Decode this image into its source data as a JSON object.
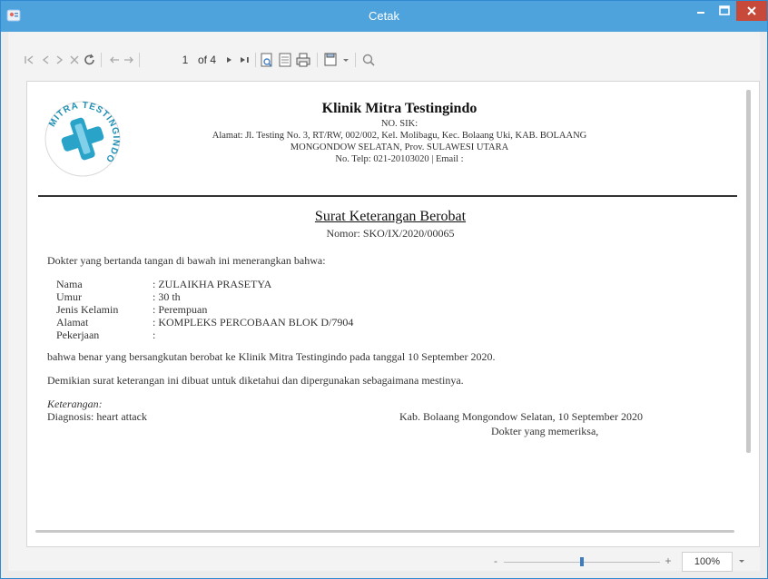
{
  "window": {
    "title": "Cetak",
    "colors": {
      "titlebar": "#4ea3dc",
      "close": "#c7493a",
      "accent": "#2f8ad1"
    }
  },
  "toolbar": {
    "page_current": "1",
    "page_total": "of 4",
    "icons": [
      "first-page-icon",
      "prev-icon",
      "next-icon",
      "stop-icon",
      "refresh-icon",
      "back-icon",
      "forward-icon",
      "first-icon",
      "prev-page-icon",
      "next-page-icon",
      "last-page-icon",
      "page-setup-icon",
      "layout-icon",
      "print-icon",
      "export-icon",
      "dropdown-icon",
      "search-icon"
    ]
  },
  "document": {
    "clinic_name": "Klinik Mitra Testingindo",
    "sik": "NO. SIK:",
    "address_line1": "Alamat: Jl. Testing No. 3, RT/RW, 002/002, Kel. Molibagu, Kec. Bolaang Uki, KAB. BOLAANG",
    "address_line2": "MONGONDOW SELATAN, Prov. SULAWESI UTARA",
    "contact": "No. Telp: 021-20103020 | Email :",
    "logo_text": "MITRA TESTINGINDO",
    "title": "Surat Keterangan Berobat",
    "number": "Nomor: SKO/IX/2020/00065",
    "intro": "Dokter yang bertanda tangan di bawah ini menerangkan bahwa:",
    "fields": [
      {
        "label": "Nama",
        "value": ": ZULAIKHA PRASETYA"
      },
      {
        "label": "Umur",
        "value": ": 30 th"
      },
      {
        "label": "Jenis Kelamin",
        "value": ": Perempuan"
      },
      {
        "label": "Alamat",
        "value": ": KOMPLEKS PERCOBAAN BLOK D/7904"
      },
      {
        "label": "Pekerjaan",
        "value": ":"
      }
    ],
    "statement": "bahwa benar yang bersangkutan berobat ke Klinik Mitra Testingindo pada tanggal 10 September 2020.",
    "closing": "Demikian surat keterangan ini dibuat untuk diketahui dan dipergunakan sebagaimana mestinya.",
    "notes_label": "Keterangan:",
    "diagnosis": "Diagnosis: heart attack",
    "place_date": "Kab. Bolaang Mongondow Selatan, 10 September 2020",
    "signer": "Dokter yang memeriksa,"
  },
  "zoom": {
    "value": "100%",
    "minus": "-",
    "plus": "+",
    "level": 0.5
  }
}
